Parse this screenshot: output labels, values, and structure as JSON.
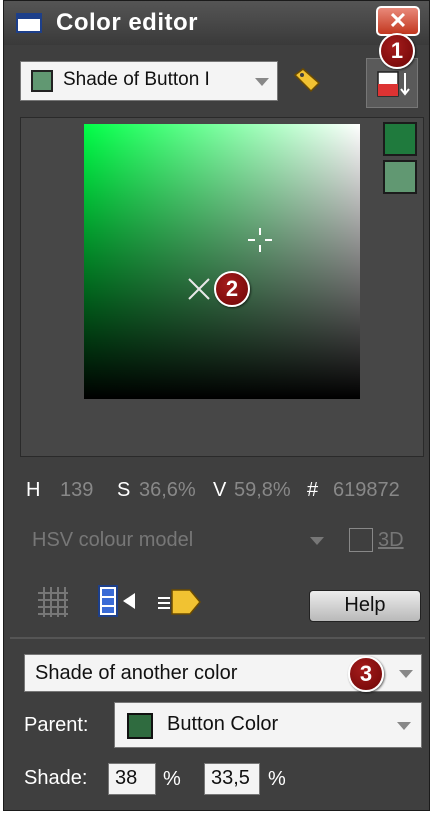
{
  "window": {
    "title": "Color editor",
    "close_glyph": "✕"
  },
  "callouts": [
    "1",
    "2",
    "3"
  ],
  "color_name": {
    "value": "Shade of Button I",
    "swatch_color": "#619872"
  },
  "colors": {
    "current": "#1f7a3d",
    "original": "#619872",
    "parent": "#2f6b3f"
  },
  "readout": {
    "h_label": "H",
    "h_value": "139",
    "s_label": "S",
    "s_value": "36,6%",
    "v_label": "V",
    "v_value": "59,8%",
    "hex_label": "#",
    "hex_value": "619872"
  },
  "model": {
    "value": "HSV colour model",
    "label_3d": "3D"
  },
  "help_label": "Help",
  "link": {
    "value": "Shade of another color"
  },
  "parent": {
    "label": "Parent:",
    "value": "Button Color"
  },
  "shade": {
    "label": "Shade:",
    "value1": "38",
    "pct1": "%",
    "value2": "33,5",
    "pct2": "%"
  },
  "icons": [
    "app-window-icon",
    "close-icon",
    "tag-icon",
    "reset-color-icon",
    "crosshair-icon",
    "x-marker-icon",
    "grid-icon",
    "slider-icon",
    "color-drop-icon",
    "chevron-down-icon"
  ]
}
